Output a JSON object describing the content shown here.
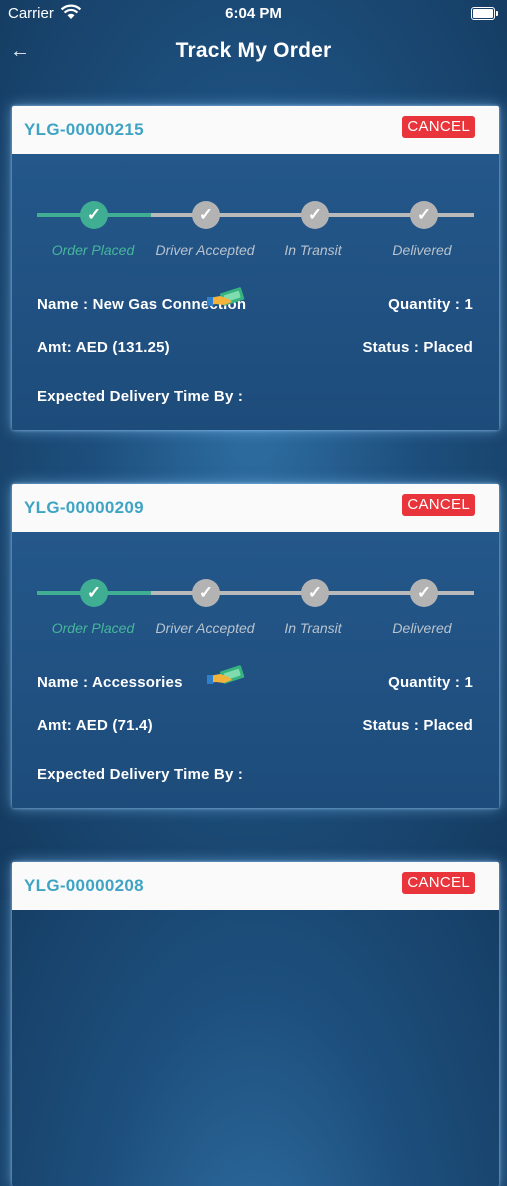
{
  "status_bar": {
    "carrier": "Carrier",
    "time": "6:04 PM"
  },
  "nav": {
    "back_icon": "←",
    "title": "Track My Order"
  },
  "steps": [
    "Order Placed",
    "Driver Accepted",
    "In Transit",
    "Delivered"
  ],
  "orders": [
    {
      "id": "YLG-00000215",
      "cancel_label": "CANCEL",
      "name": "Name : New Gas Connection",
      "quantity": "Quantity : 1",
      "amount": "Amt: AED (131.25)",
      "status": "Status : Placed",
      "expected_delivery": "Expected Delivery Time By :",
      "completed_steps": 1
    },
    {
      "id": "YLG-00000209",
      "cancel_label": "CANCEL",
      "name": "Name : Accessories",
      "quantity": "Quantity : 1",
      "amount": "Amt: AED (71.4)",
      "status": "Status : Placed",
      "expected_delivery": "Expected Delivery Time By :",
      "completed_steps": 1
    },
    {
      "id": "YLG-00000208",
      "cancel_label": "CANCEL"
    }
  ],
  "colors": {
    "accent_green": "#3fae92",
    "order_id_blue": "#3fa4c4",
    "cancel_red": "#e8343a"
  }
}
